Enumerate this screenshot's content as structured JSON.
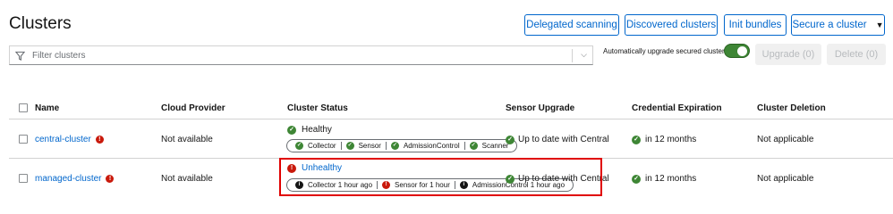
{
  "page": {
    "title": "Clusters"
  },
  "toolbar": {
    "delegated_scanning": "Delegated scanning",
    "discovered_clusters": "Discovered clusters",
    "init_bundles": "Init bundles",
    "secure_cluster": "Secure a cluster"
  },
  "filter": {
    "placeholder": "Filter clusters"
  },
  "auto_upgrade": {
    "label": "Automatically upgrade secured clusters",
    "enabled": true
  },
  "actions": {
    "upgrade": "Upgrade (0)",
    "delete": "Delete (0)"
  },
  "table": {
    "columns": [
      "Name",
      "Cloud Provider",
      "Cluster Status",
      "Sensor Upgrade",
      "Credential Expiration",
      "Cluster Deletion"
    ],
    "rows": [
      {
        "name": "central-cluster",
        "cloud_provider": "Not available",
        "status": "Healthy",
        "components": [
          "Collector",
          "Sensor",
          "AdmissionControl",
          "Scanner"
        ],
        "sensor_upgrade": "Up to date with Central",
        "credential_expiration": "in 12 months",
        "cluster_deletion": "Not applicable"
      },
      {
        "name": "managed-cluster",
        "cloud_provider": "Not available",
        "status": "Unhealthy",
        "components": [
          "Collector 1 hour ago",
          "Sensor for 1 hour",
          "AdmissionControl 1 hour ago"
        ],
        "sensor_upgrade": "Up to date with Central",
        "credential_expiration": "in 12 months",
        "cluster_deletion": "Not applicable"
      }
    ]
  },
  "colors": {
    "link": "#0066cc",
    "healthy": "#3e8635",
    "error": "#c9190b",
    "highlight": "#e00000"
  }
}
